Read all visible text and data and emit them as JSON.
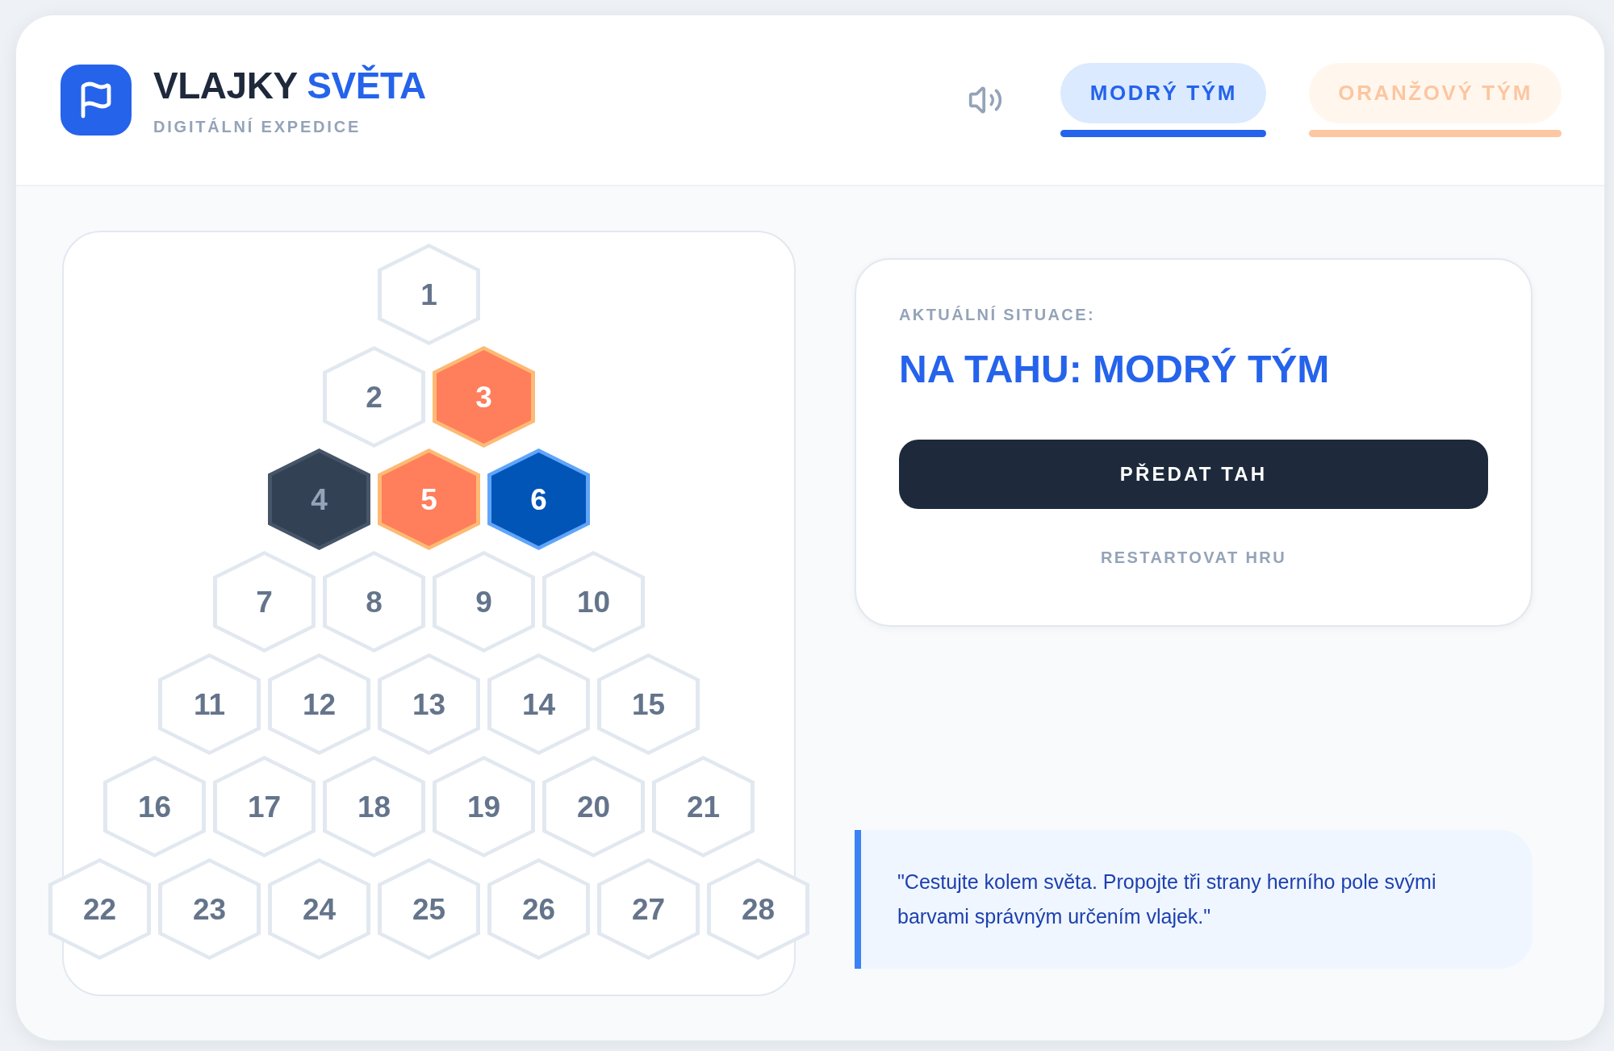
{
  "header": {
    "title": [
      {
        "text": "VLAJKY",
        "kind": "plain"
      },
      {
        "text": "SVĚTA",
        "kind": "accent"
      }
    ],
    "subtitle": "DIGITÁLNÍ EXPEDICE",
    "sound_on": true,
    "tabs": [
      {
        "label": "MODRÝ TÝM",
        "kind": "blue",
        "selected": true
      },
      {
        "label": "ORANŽOVÝ TÝM",
        "kind": "orange",
        "selected": false
      }
    ]
  },
  "board": {
    "rows": [
      {
        "hexes": [
          {
            "label": "1",
            "kind": "empty"
          }
        ]
      },
      {
        "hexes": [
          {
            "label": "2",
            "kind": "empty"
          },
          {
            "label": "3",
            "kind": "orange"
          }
        ]
      },
      {
        "hexes": [
          {
            "label": "4",
            "kind": "blocked"
          },
          {
            "label": "5",
            "kind": "orange"
          },
          {
            "label": "6",
            "kind": "blue"
          }
        ]
      },
      {
        "hexes": [
          {
            "label": "7",
            "kind": "empty"
          },
          {
            "label": "8",
            "kind": "empty"
          },
          {
            "label": "9",
            "kind": "empty"
          },
          {
            "label": "10",
            "kind": "empty"
          }
        ]
      },
      {
        "hexes": [
          {
            "label": "11",
            "kind": "empty"
          },
          {
            "label": "12",
            "kind": "empty"
          },
          {
            "label": "13",
            "kind": "empty"
          },
          {
            "label": "14",
            "kind": "empty"
          },
          {
            "label": "15",
            "kind": "empty"
          }
        ]
      },
      {
        "hexes": [
          {
            "label": "16",
            "kind": "empty"
          },
          {
            "label": "17",
            "kind": "empty"
          },
          {
            "label": "18",
            "kind": "empty"
          },
          {
            "label": "19",
            "kind": "empty"
          },
          {
            "label": "20",
            "kind": "empty"
          },
          {
            "label": "21",
            "kind": "empty"
          }
        ]
      },
      {
        "hexes": [
          {
            "label": "22",
            "kind": "empty"
          },
          {
            "label": "23",
            "kind": "empty"
          },
          {
            "label": "24",
            "kind": "empty"
          },
          {
            "label": "25",
            "kind": "empty"
          },
          {
            "label": "26",
            "kind": "empty"
          },
          {
            "label": "27",
            "kind": "empty"
          },
          {
            "label": "28",
            "kind": "empty"
          }
        ]
      }
    ]
  },
  "status_panel": {
    "label": "AKTUÁLNÍ SITUACE:",
    "turn": "NA TAHU: MODRÝ TÝM",
    "primary_button": "PŘEDAT TAH",
    "secondary_button": "RESTARTOVAT HRU"
  },
  "quote": "\"Cestujte kolem světa. Propojte tři strany herního pole svými barvami správným určením vlajek.\""
}
